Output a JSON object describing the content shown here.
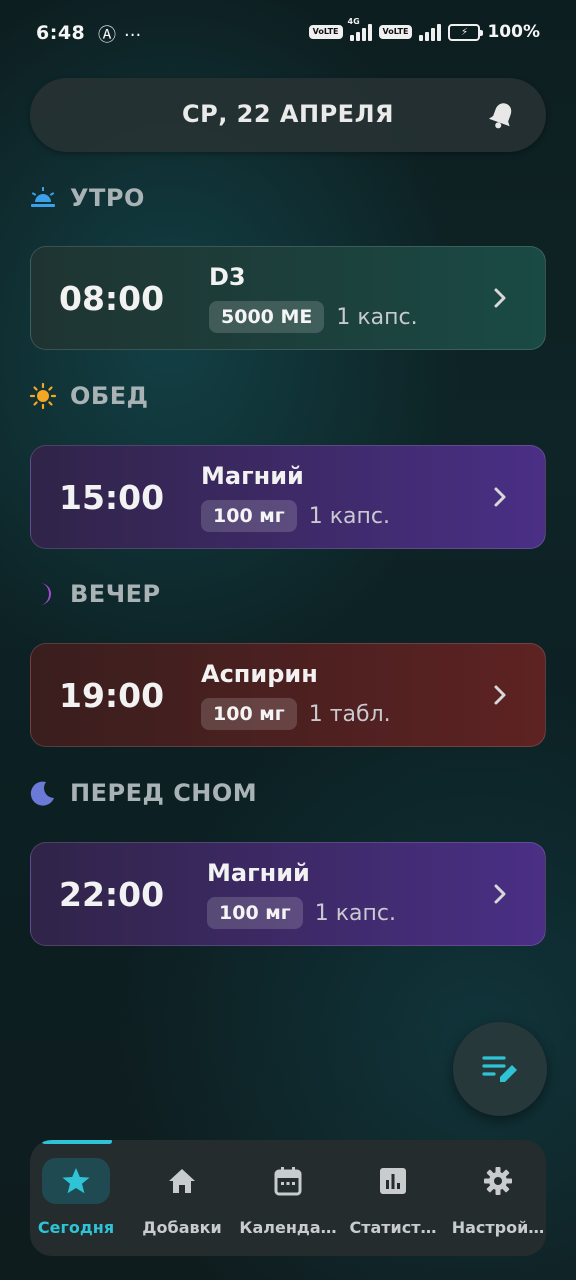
{
  "status_bar": {
    "time": "6:48",
    "left_icons": [
      "app-notification-icon",
      "more-icon"
    ],
    "network_tag": "4G",
    "volte_label": "Vo LTE",
    "battery_percent": "100%"
  },
  "header": {
    "date": "СР, 22 АПРЕЛЯ",
    "bell_icon": "bell-icon"
  },
  "sections": [
    {
      "title": "УТРО",
      "icon": "sunrise-icon",
      "icon_color": "#3aa0e8",
      "dose": {
        "time": "08:00",
        "name": "D3",
        "amount": "5000 МЕ",
        "quantity": "1 капс.",
        "color": "green"
      }
    },
    {
      "title": "ОБЕД",
      "icon": "sun-icon",
      "icon_color": "#f5a623",
      "dose": {
        "time": "15:00",
        "name": "Магний",
        "amount": "100 мг",
        "quantity": "1 капс.",
        "color": "purple"
      }
    },
    {
      "title": "ВЕЧЕР",
      "icon": "crescent-icon",
      "icon_color": "#a64bd6",
      "dose": {
        "time": "19:00",
        "name": "Аспирин",
        "amount": "100 мг",
        "quantity": "1 табл.",
        "color": "red"
      }
    },
    {
      "title": "ПЕРЕД СНОМ",
      "icon": "moon-icon",
      "icon_color": "#6b7ad6",
      "dose": {
        "time": "22:00",
        "name": "Магний",
        "amount": "100 мг",
        "quantity": "1 капс.",
        "color": "purple"
      }
    }
  ],
  "fab": {
    "icon": "edit-list-icon",
    "color": "#2ec4d6"
  },
  "nav": {
    "accent": "#2ec4d6",
    "items": [
      {
        "label": "Сегодня",
        "icon": "star-icon",
        "active": true
      },
      {
        "label": "Добавки",
        "icon": "home-icon",
        "active": false
      },
      {
        "label": "Календа…",
        "icon": "calendar-icon",
        "active": false
      },
      {
        "label": "Статист…",
        "icon": "chart-icon",
        "active": false
      },
      {
        "label": "Настрой…",
        "icon": "gear-icon",
        "active": false
      }
    ]
  }
}
